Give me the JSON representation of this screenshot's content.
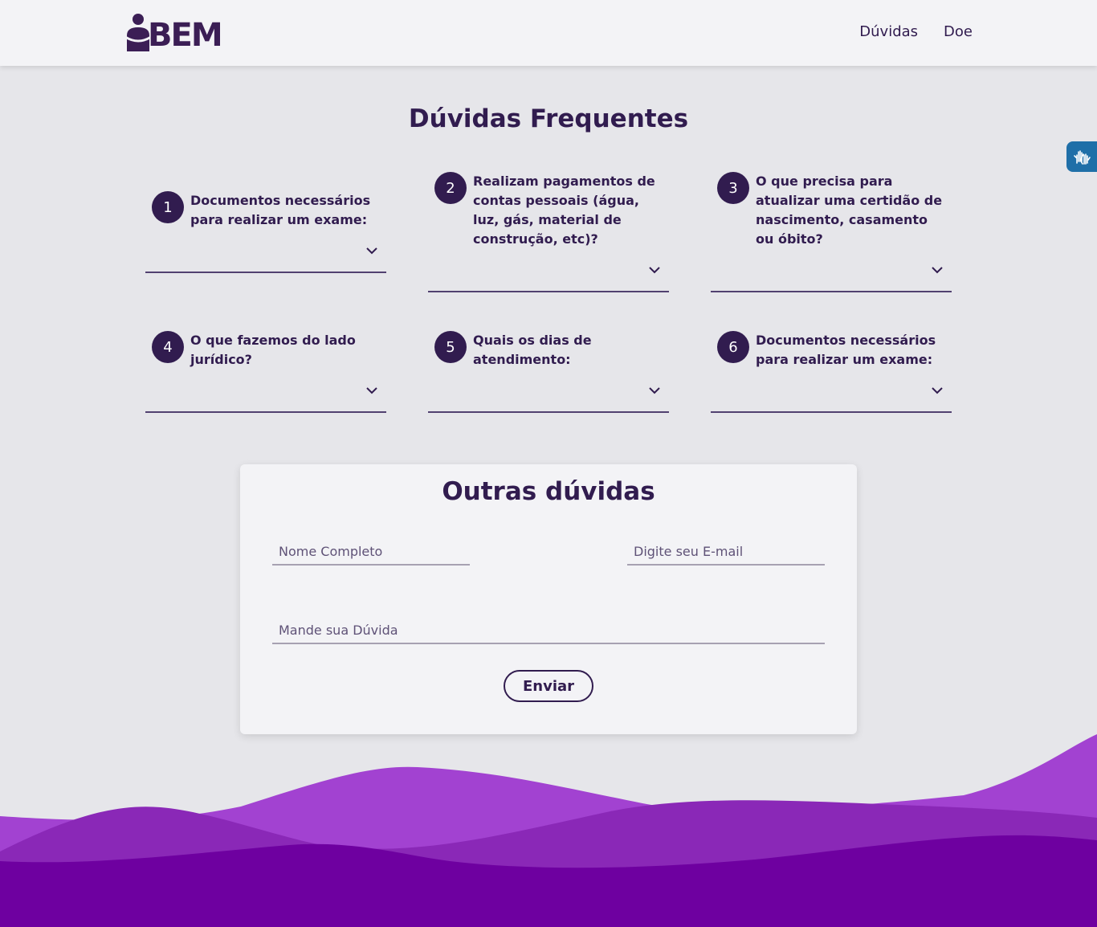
{
  "header": {
    "logo_text": "BEM",
    "nav": [
      {
        "label": "Dúvidas"
      },
      {
        "label": "Doe"
      }
    ]
  },
  "faq": {
    "title": "Dúvidas Frequentes",
    "items": [
      {
        "number": "1",
        "question": "Documentos necessários para realizar um exame:"
      },
      {
        "number": "2",
        "question": "Realizam pagamentos de contas pessoais (água, luz, gás, material de construção, etc)?"
      },
      {
        "number": "3",
        "question": "O que precisa para atualizar uma certidão de nascimento, casamento ou óbito?"
      },
      {
        "number": "4",
        "question": "O que fazemos do lado jurídico?"
      },
      {
        "number": "5",
        "question": "Quais os dias de atendimento:"
      },
      {
        "number": "6",
        "question": "Documentos necessários para realizar um exame:"
      }
    ]
  },
  "form": {
    "title": "Outras dúvidas",
    "name_placeholder": "Nome Completo",
    "email_placeholder": "Digite seu E-mail",
    "question_placeholder": "Mande sua Dúvida",
    "submit_label": "Enviar"
  },
  "colors": {
    "primary": "#311c4f",
    "background": "#e6e6ea",
    "wave_light": "#a242d1",
    "wave_mid": "#8a28b7",
    "wave_dark": "#6e00a0",
    "accessibility": "#1f6fa8"
  },
  "icons": {
    "logo": "person-logo-icon",
    "accessibility": "sign-language-hands-icon",
    "accordion": "chevron-down-icon"
  }
}
